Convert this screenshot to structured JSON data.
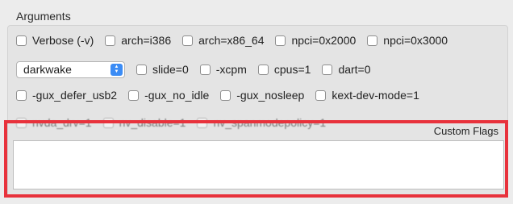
{
  "group_title": "Arguments",
  "row1": [
    {
      "label": "Verbose (-v)",
      "checked": false
    },
    {
      "label": "arch=i386",
      "checked": false
    },
    {
      "label": "arch=x86_64",
      "checked": false
    },
    {
      "label": "npci=0x2000",
      "checked": false
    },
    {
      "label": "npci=0x3000",
      "checked": false
    }
  ],
  "dropdown": {
    "value": "darkwake"
  },
  "row2": [
    {
      "label": "slide=0",
      "checked": false
    },
    {
      "label": "-xcpm",
      "checked": false
    },
    {
      "label": "cpus=1",
      "checked": false
    },
    {
      "label": "dart=0",
      "checked": false
    }
  ],
  "row3": [
    {
      "label": "-gux_defer_usb2",
      "checked": false
    },
    {
      "label": "-gux_no_idle",
      "checked": false
    },
    {
      "label": "-gux_nosleep",
      "checked": false
    },
    {
      "label": "kext-dev-mode=1",
      "checked": false
    }
  ],
  "row4": [
    {
      "label": "nvda_drv=1",
      "checked": false
    },
    {
      "label": "nv_disable=1",
      "checked": false
    },
    {
      "label": "nv_spanmodepolicy=1",
      "checked": false
    }
  ],
  "custom_flags": {
    "label": "Custom Flags",
    "value": ""
  },
  "colors": {
    "highlight": "#e8323c",
    "accent": "#3b8cf5"
  }
}
